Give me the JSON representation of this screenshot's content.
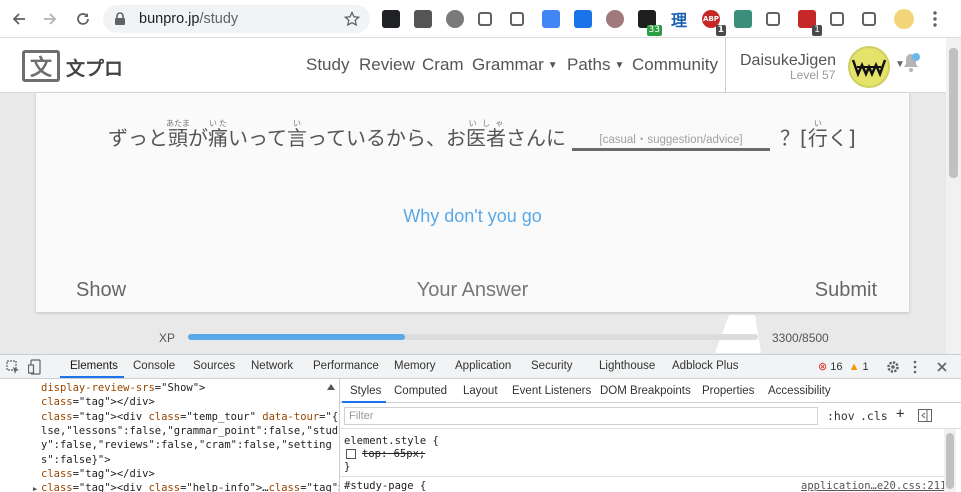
{
  "browser": {
    "url_domain": "bunpro.jp",
    "url_path": "/study",
    "extensions": [
      {
        "name": "ext-dark-icon",
        "color": "#202124"
      },
      {
        "name": "ext-mask-icon",
        "color": "#555555"
      },
      {
        "name": "ext-gear-icon",
        "color": "#7a7a7a"
      },
      {
        "name": "ext-pocket-icon",
        "color": "#5f6368"
      },
      {
        "name": "ext-list-icon",
        "color": "#5f6368"
      },
      {
        "name": "ext-translate-icon",
        "color": "#4285f4"
      },
      {
        "name": "ext-s-blue-icon",
        "color": "#1a73e8"
      },
      {
        "name": "ext-play-icon",
        "color": "#a07a7a"
      },
      {
        "name": "ext-d-icon",
        "color": "#1e1e1e",
        "badge": "33"
      },
      {
        "name": "ext-kanji-icon",
        "color": "#1a5fb4",
        "text": "理"
      },
      {
        "name": "ext-abp-icon",
        "color": "#c62828",
        "badge": "1",
        "text": "ABP"
      },
      {
        "name": "ext-s-green-icon",
        "color": "#3a8f7a"
      },
      {
        "name": "ext-picture-icon",
        "color": "#5f6368"
      },
      {
        "name": "ext-grid-icon",
        "color": "#c62828",
        "badge": "1"
      },
      {
        "name": "extensions-puzzle-icon",
        "color": "#5f6368"
      },
      {
        "name": "media-control-icon",
        "color": "#5f6368"
      },
      {
        "name": "profile-avatar-icon",
        "color": "#f2d47a"
      }
    ]
  },
  "site": {
    "logo_glyph": "文",
    "logo_text": "文プロ",
    "nav": [
      {
        "label": "Study",
        "dropdown": false
      },
      {
        "label": "Review",
        "dropdown": false
      },
      {
        "label": "Cram",
        "dropdown": false
      },
      {
        "label": "Grammar",
        "dropdown": true
      },
      {
        "label": "Paths",
        "dropdown": true
      },
      {
        "label": "Community",
        "dropdown": false
      }
    ],
    "username": "DaisukeJigen",
    "level": "Level 57"
  },
  "study": {
    "sentence_before": [
      {
        "text": "ずっと"
      },
      {
        "text": "頭",
        "ruby": "あたま"
      },
      {
        "text": "が"
      },
      {
        "text": "痛",
        "ruby": "いた"
      },
      {
        "text": "いって"
      },
      {
        "text": "言",
        "ruby": "い"
      },
      {
        "text": "っているから、お"
      },
      {
        "text": "医者",
        "ruby": "いしゃ"
      },
      {
        "text": "さんに"
      }
    ],
    "blank_hint": "[casual・suggestion/advice]",
    "sentence_after": [
      {
        "text": "？["
      },
      {
        "text": "行",
        "ruby": "い"
      },
      {
        "text": "く]"
      }
    ],
    "hint": "Why don't you go",
    "show_label": "Show",
    "answer_placeholder": "Your Answer",
    "submit_label": "Submit"
  },
  "xp": {
    "label": "XP",
    "current": 3300,
    "max": 8500,
    "text": "3300/8500",
    "fill_fraction": 0.38
  },
  "devtools": {
    "tabs": [
      "Elements",
      "Console",
      "Sources",
      "Network",
      "Performance",
      "Memory",
      "Application",
      "Security",
      "Lighthouse",
      "Adblock Plus"
    ],
    "errors": "16",
    "warnings": "1",
    "dom_lines": [
      "display-review-srs=\"Show\">",
      "</div>",
      "<div class=\"temp_tour\" data-tour=\"{\"profile\":fa",
      "lse,\"lessons\":false,\"grammar_point\":false,\"stud",
      "y\":false,\"reviews\":false,\"cram\":false,\"setting",
      "s\":false}\">",
      "</div>",
      "<div class=\"help-info\">…</div>"
    ],
    "style_tabs": [
      "Styles",
      "Computed",
      "Layout",
      "Event Listeners",
      "DOM Breakpoints",
      "Properties",
      "Accessibility"
    ],
    "filter_placeholder": "Filter",
    "hov": ":hov",
    "cls": ".cls",
    "element_style": "element.style {",
    "struck_rule": "top: 65px;",
    "closing_brace": "}",
    "selector": "#study-page {",
    "source": "application…e20.css:211"
  }
}
